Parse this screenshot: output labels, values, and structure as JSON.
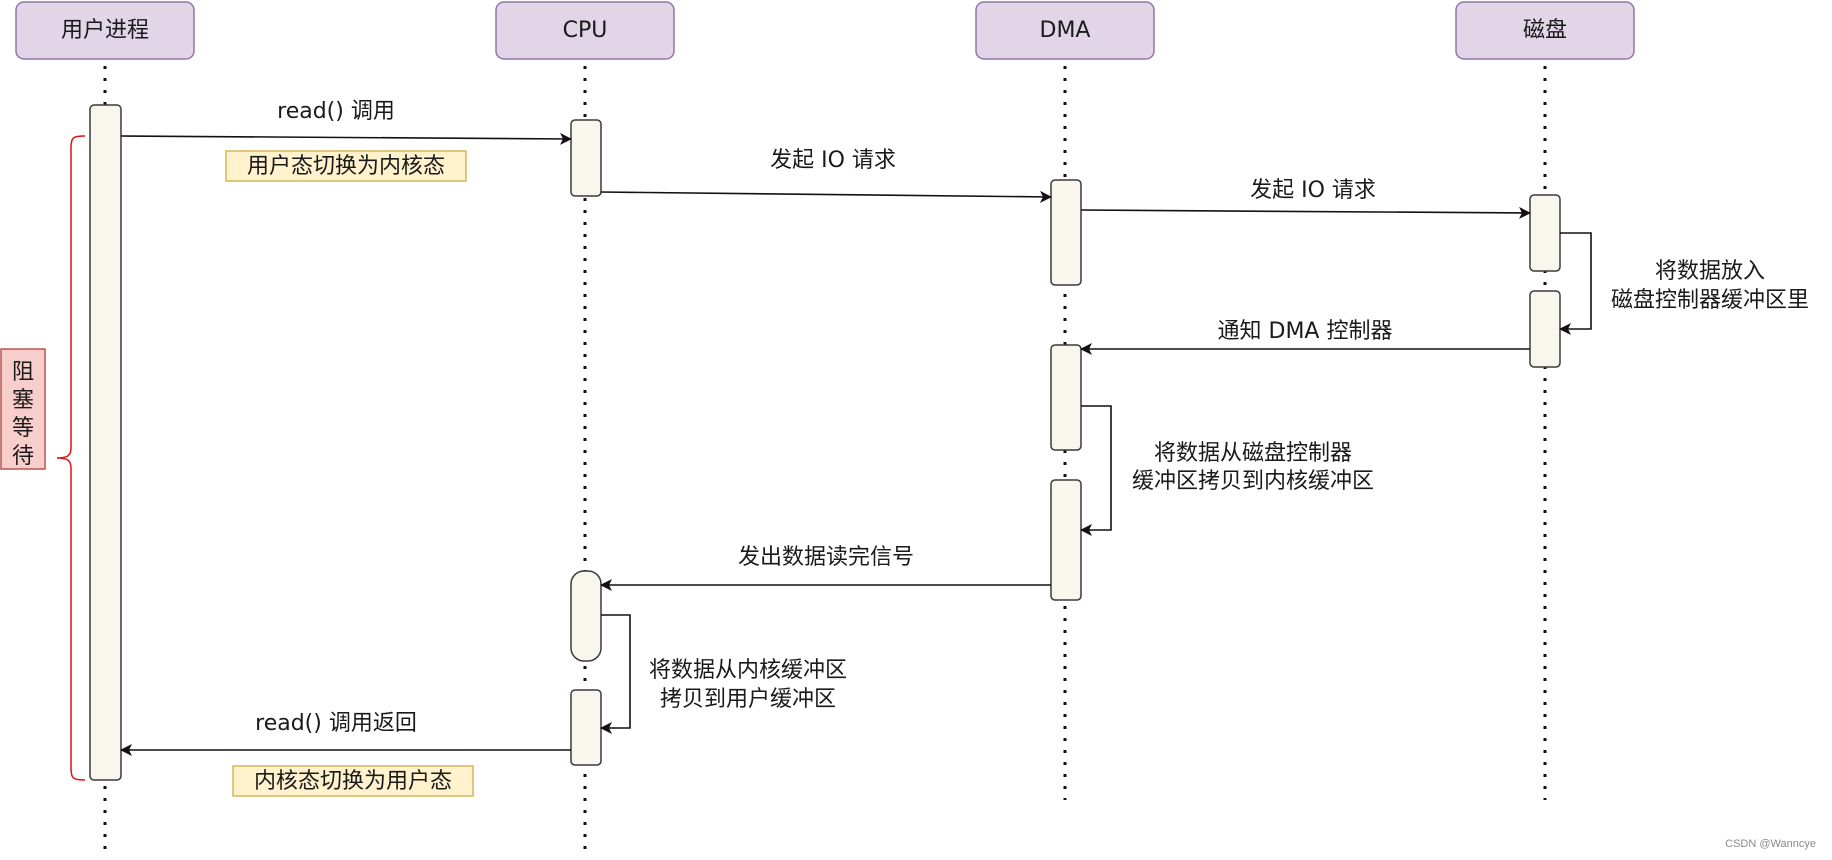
{
  "diagram": {
    "type": "sequence",
    "participants": [
      {
        "id": "user",
        "label": "用户进程"
      },
      {
        "id": "cpu",
        "label": "CPU"
      },
      {
        "id": "dma",
        "label": "DMA"
      },
      {
        "id": "disk",
        "label": "磁盘"
      }
    ],
    "messages": [
      {
        "from": "user",
        "to": "cpu",
        "label": "read() 调用"
      },
      {
        "from": "cpu",
        "to": "dma",
        "label": "发起 IO 请求"
      },
      {
        "from": "dma",
        "to": "disk",
        "label": "发起 IO 请求"
      },
      {
        "from": "disk",
        "to": "disk",
        "label_lines": [
          "将数据放入",
          "磁盘控制器缓冲区里"
        ]
      },
      {
        "from": "disk",
        "to": "dma",
        "label": "通知 DMA 控制器"
      },
      {
        "from": "dma",
        "to": "dma",
        "label_lines": [
          "将数据从磁盘控制器",
          "缓冲区拷贝到内核缓冲区"
        ]
      },
      {
        "from": "dma",
        "to": "cpu",
        "label": "发出数据读完信号"
      },
      {
        "from": "cpu",
        "to": "cpu",
        "label_lines": [
          "将数据从内核缓冲区",
          "拷贝到用户缓冲区"
        ]
      },
      {
        "from": "cpu",
        "to": "user",
        "label": "read() 调用返回"
      }
    ],
    "notes": [
      {
        "after_message": 0,
        "text": "用户态切换为内核态"
      },
      {
        "after_message": 8,
        "text": "内核态切换为用户态"
      }
    ],
    "blocking": {
      "participant": "user",
      "label_chars": [
        "阻",
        "塞",
        "等",
        "待"
      ],
      "label": "阻塞等待"
    }
  },
  "watermark": "CSDN @Wanncye",
  "colors": {
    "participant_fill": "#e1d5e7",
    "participant_border": "#9673a6",
    "activation_fill": "#f9f7ed",
    "note_fill": "#fff2cc",
    "note_border": "#d6b656",
    "block_fill": "#f8cecc",
    "block_border": "#b85450",
    "bracket": "#e01010"
  }
}
